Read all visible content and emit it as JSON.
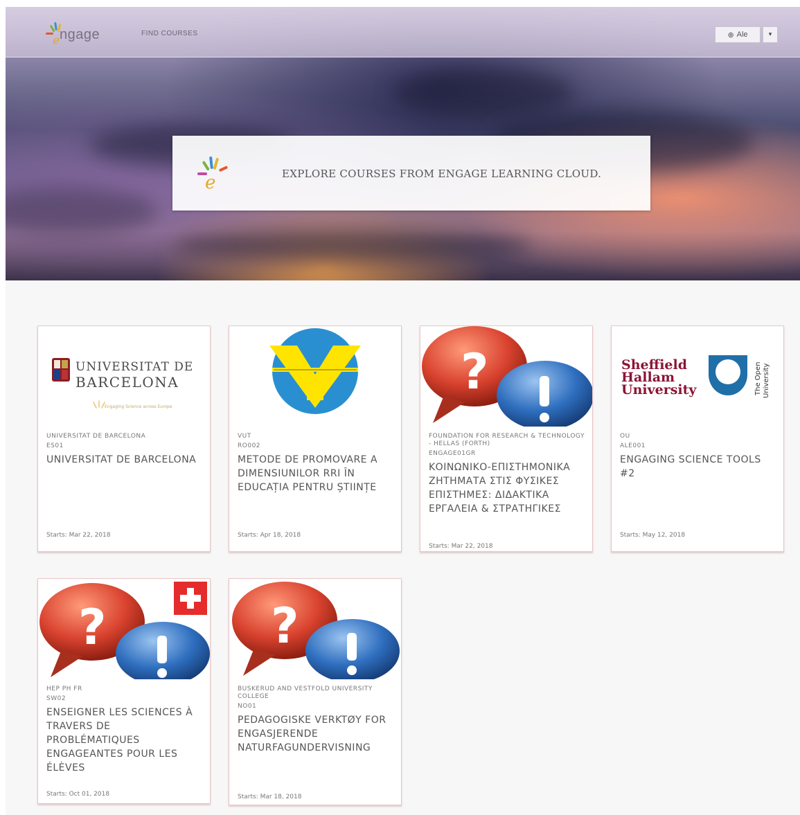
{
  "header": {
    "logo_text": "ngage",
    "nav_find_courses": "FIND COURSES",
    "user_initial": "⊕",
    "user_name": "Ale",
    "user_caret": "▾"
  },
  "banner": {
    "text": "EXPLORE COURSES FROM ENGAGE LEARNING CLOUD."
  },
  "courses": [
    {
      "org": "UNIVERSITAT DE BARCELONA",
      "code": "ES01",
      "title": "UNIVERSITAT DE BARCELONA",
      "start": "Starts: Mar 22, 2018",
      "image": "universitat-de-barcelona-logo",
      "image_text": [
        "UNIVERSITAT DE",
        "BARCELONA",
        "Engaging Science across Europe"
      ]
    },
    {
      "org": "VUT",
      "code": "RO002",
      "title": "METODE DE PROMOVARE A DIMENSIUNILOR RRI ÎN EDUCAȚIA PENTRU ȘTIINȚE",
      "start": "Starts: Apr 18, 2018",
      "image": "vut-logo"
    },
    {
      "org": "FOUNDATION FOR RESEARCH & TECHNOLOGY - HELLAS (FORTH)",
      "code": "ENGAGE01GR",
      "title": "ΚΟΙΝΩΝΙΚΟ-ΕΠΙΣΤΗΜΟΝΙΚΑ ΖΗΤΗΜΑΤΑ ΣΤΙΣ ΦΥΣΙΚΕΣ ΕΠΙΣΤΗΜΕΣ: ΔΙΔΑΚΤΙΚΑ ΕΡΓΑΛΕΙΑ & ΣΤΡΑΤΗΓΙΚΕΣ",
      "start": "Starts: Mar 22, 2018",
      "image": "question-exclamation-bubbles"
    },
    {
      "org": "OU",
      "code": "ALE001",
      "title": "ENGAGING SCIENCE TOOLS #2",
      "start": "Starts: May 12, 2018",
      "image": "sheffield-hallam-open-university-logo",
      "image_text": [
        "Sheffield",
        "Hallam",
        "University",
        "The Open",
        "University"
      ]
    },
    {
      "org": "HEP PH FR",
      "code": "SW02",
      "title": "ENSEIGNER LES SCIENCES À TRAVERS DE PROBLÉMATIQUES ENGAGEANTES POUR LES ÉLÈVES",
      "start": "Starts: Oct 01, 2018",
      "image": "question-exclamation-bubbles-swiss-flag"
    },
    {
      "org": "BUSKERUD AND VESTFOLD UNIVERSITY COLLEGE",
      "code": "NO01",
      "title": "PEDAGOGISKE VERKTØY FOR ENGASJERENDE NATURFAGUNDERVISNING",
      "start": "Starts: Mar 18, 2018",
      "image": "question-exclamation-bubbles"
    }
  ],
  "colors": {
    "card_border": "#e8c6c6",
    "bubble_red": "#d9432f",
    "bubble_blue": "#2f6fbf",
    "ub_red": "#8b1c24",
    "shu_maroon": "#8b1535",
    "ou_blue": "#1f6fa8",
    "vut_blue": "#2a8fd0",
    "vut_yellow": "#ffe400"
  }
}
